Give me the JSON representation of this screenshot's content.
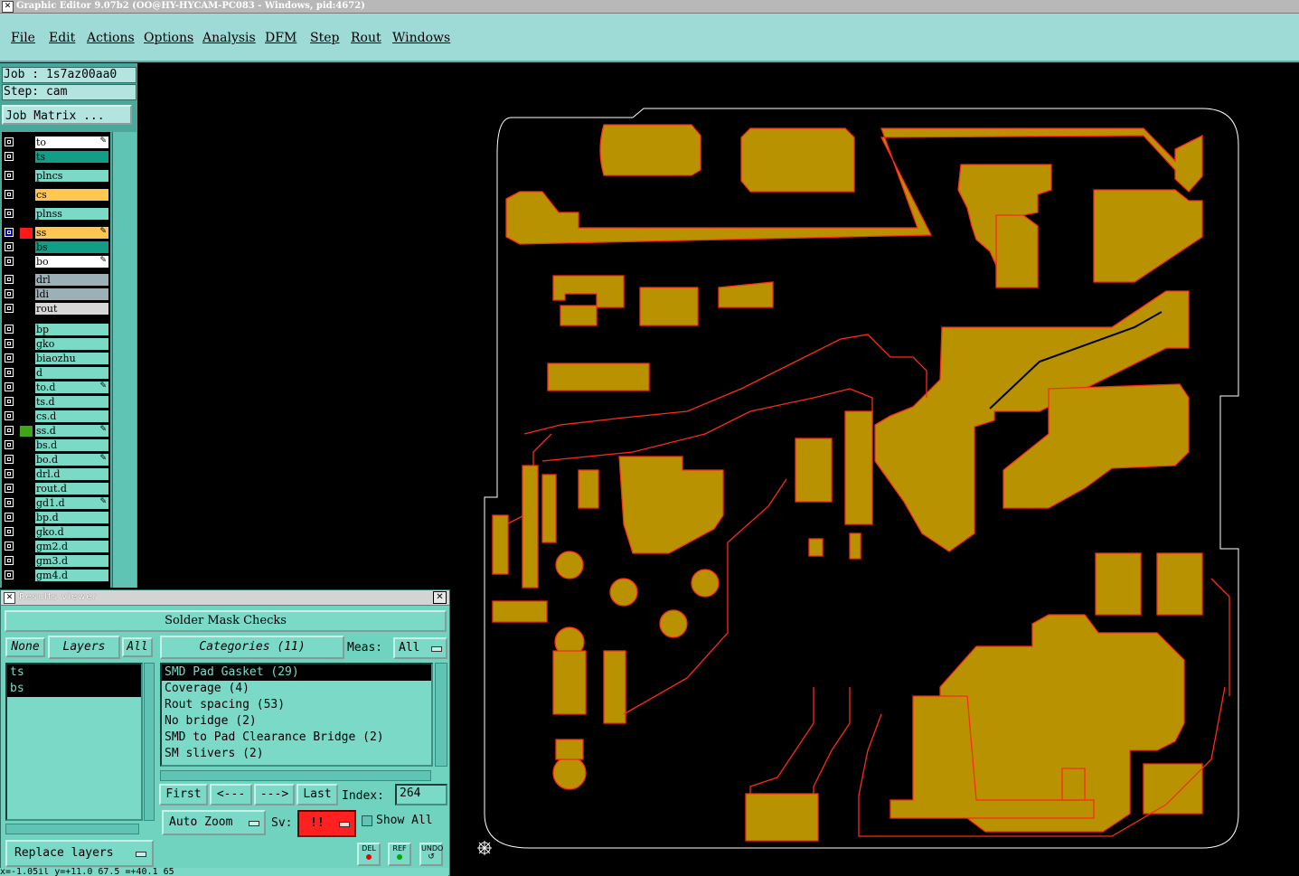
{
  "window": {
    "title": "Graphic Editor 9.07b2  (OO@HY-HYCAM-PC083 - Windows, pid:4672)"
  },
  "menu": [
    "File",
    "Edit",
    "Actions",
    "Options",
    "Analysis",
    "DFM",
    "Step",
    "Rout",
    "Windows"
  ],
  "job": {
    "job_label": "Job : 1s7az00aa0",
    "step_label": "Step: cam",
    "matrix_button": "Job Matrix ..."
  },
  "layers": [
    {
      "name": "to",
      "color": "#ffffff",
      "edit": true
    },
    {
      "name": "ts",
      "color": "#109f86"
    },
    {
      "name": "plncs",
      "color": "#7ad9c7"
    },
    {
      "name": "cs",
      "color": "#ffc74f"
    },
    {
      "name": "plnss",
      "color": "#7ad9c7"
    },
    {
      "name": "ss",
      "color": "#ffc74f",
      "edit": true,
      "selected": true,
      "swatch": "#ff1a1a"
    },
    {
      "name": "bs",
      "color": "#109f86"
    },
    {
      "name": "bo",
      "color": "#ffffff",
      "edit": true
    },
    {
      "name": "drl",
      "color": "#9cb1b7"
    },
    {
      "name": "ldi",
      "color": "#9cb1b7"
    },
    {
      "name": "rout",
      "color": "#d7d7d7"
    },
    {
      "name": "bp",
      "color": "#7ad9c7"
    },
    {
      "name": "gko",
      "color": "#7ad9c7"
    },
    {
      "name": "biaozhu",
      "color": "#7ad9c7"
    },
    {
      "name": "d",
      "color": "#7ad9c7"
    },
    {
      "name": "to.d",
      "color": "#7ad9c7",
      "edit": true
    },
    {
      "name": "ts.d",
      "color": "#7ad9c7"
    },
    {
      "name": "cs.d",
      "color": "#7ad9c7"
    },
    {
      "name": "ss.d",
      "color": "#7ad9c7",
      "edit": true,
      "swatch": "#3fa51a"
    },
    {
      "name": "bs.d",
      "color": "#7ad9c7"
    },
    {
      "name": "bo.d",
      "color": "#7ad9c7",
      "edit": true
    },
    {
      "name": "drl.d",
      "color": "#7ad9c7"
    },
    {
      "name": "rout.d",
      "color": "#7ad9c7"
    },
    {
      "name": "gd1.d",
      "color": "#7ad9c7",
      "edit": true
    },
    {
      "name": "bp.d",
      "color": "#7ad9c7"
    },
    {
      "name": "gko.d",
      "color": "#7ad9c7"
    },
    {
      "name": "gm2.d",
      "color": "#7ad9c7"
    },
    {
      "name": "gm3.d",
      "color": "#7ad9c7"
    },
    {
      "name": "gm4.d",
      "color": "#7ad9c7"
    }
  ],
  "results_viewer": {
    "window_title": "Results viewer",
    "header": "Solder Mask Checks",
    "none_button": "None",
    "layers_button": "Layers",
    "all_button": "All",
    "layer_items": [
      "ts",
      "bs"
    ],
    "categories_button": "Categories (11)",
    "meas_label": "Meas:",
    "meas_value": "All",
    "categories": [
      "SMD Pad Gasket (29)",
      "Coverage (4)",
      "Rout spacing (53)",
      "No bridge (2)",
      "SMD to Pad Clearance Bridge (2)",
      "SM slivers (2)"
    ],
    "first_button": "First",
    "prev_button": "<---",
    "next_button": "--->",
    "last_button": "Last",
    "index_label": "Index:",
    "index_value": "264",
    "auto_zoom": "Auto Zoom",
    "sv_label": "Sv:",
    "sv_value": "!!",
    "show_all": "Show All",
    "replace_layers": "Replace layers",
    "del_button": "DEL",
    "ref_button": "REF",
    "undo_button": "UNDO",
    "status_text": "x=-1.05il  y=+11.0 67.5  =+40.1 65"
  },
  "icon": {
    "crosshair": "crosshair-icon"
  }
}
